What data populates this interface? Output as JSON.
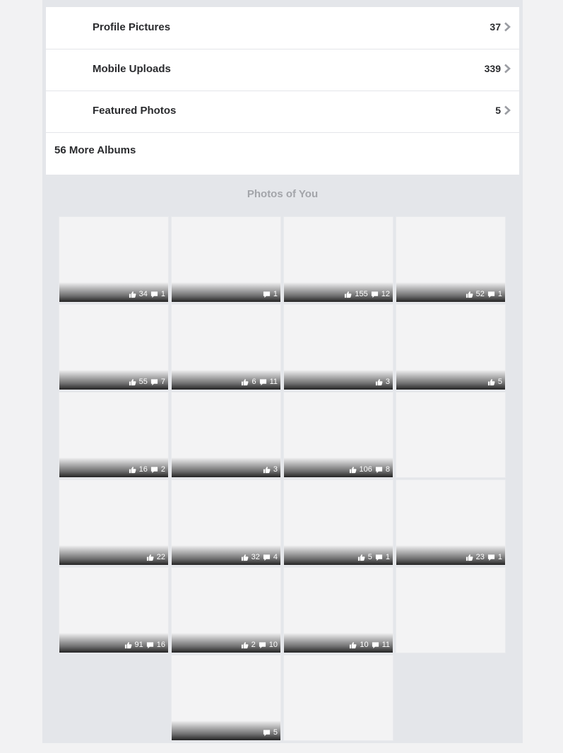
{
  "albums": [
    {
      "name": "Profile Pictures",
      "count": "37",
      "icon": "chevron-right-icon"
    },
    {
      "name": "Mobile Uploads",
      "count": "339",
      "icon": "chevron-right-icon"
    },
    {
      "name": "Featured Photos",
      "count": "5",
      "icon": "chevron-right-icon"
    }
  ],
  "more_albums_label": "56 More Albums",
  "photos_section_title": "Photos of You",
  "photos": [
    {
      "likes": "34",
      "comments": "1"
    },
    {
      "likes": "",
      "comments": "1"
    },
    {
      "likes": "155",
      "comments": "12"
    },
    {
      "likes": "52",
      "comments": "1"
    },
    {
      "likes": "55",
      "comments": "7"
    },
    {
      "likes": "6",
      "comments": "11"
    },
    {
      "likes": "3",
      "comments": ""
    },
    {
      "likes": "5",
      "comments": ""
    },
    {
      "likes": "16",
      "comments": "2"
    },
    {
      "likes": "3",
      "comments": ""
    },
    {
      "likes": "106",
      "comments": "8"
    },
    {
      "likes": "",
      "comments": ""
    },
    {
      "likes": "22",
      "comments": ""
    },
    {
      "likes": "32",
      "comments": "4"
    },
    {
      "likes": "5",
      "comments": "1"
    },
    {
      "likes": "23",
      "comments": "1"
    },
    {
      "likes": "91",
      "comments": "16"
    },
    {
      "likes": "2",
      "comments": "10"
    },
    {
      "likes": "10",
      "comments": "11"
    },
    {
      "likes": "",
      "comments": ""
    },
    {
      "likes": "",
      "comments": "5"
    },
    {
      "likes": "",
      "comments": ""
    }
  ],
  "icons": {
    "like": "thumbs-up-icon",
    "comment": "comment-icon",
    "chevron": "chevron-right-icon"
  },
  "colors": {
    "text": "#2a2b2e",
    "section_title": "#a3a5aa",
    "page_bg": "#e4e6ea"
  }
}
